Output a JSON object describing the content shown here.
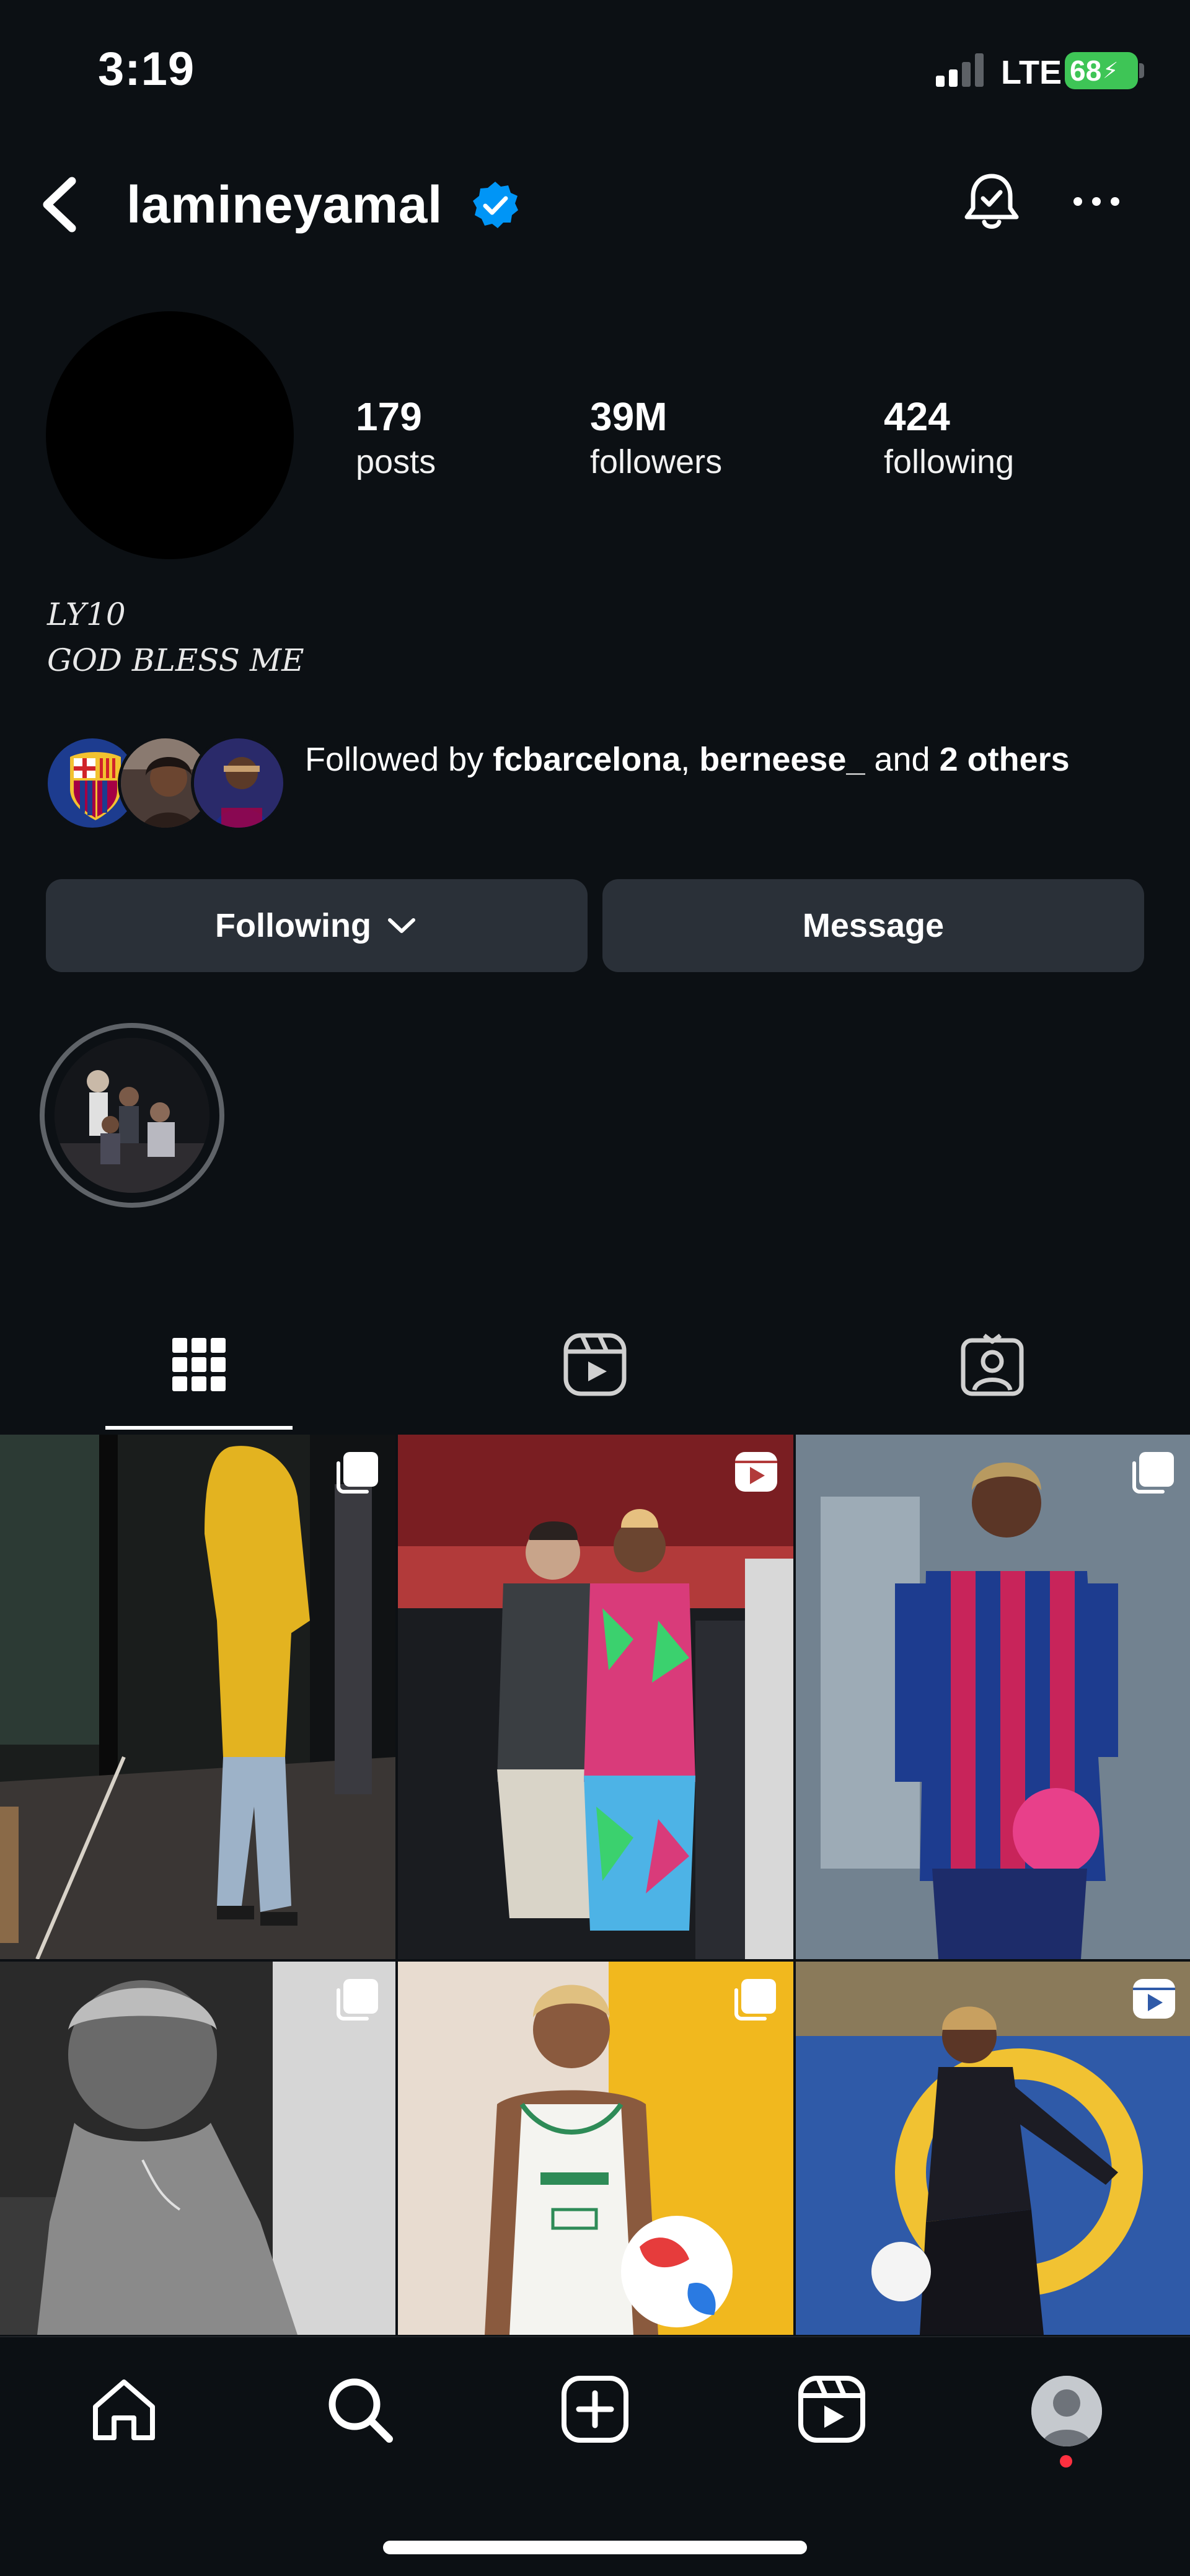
{
  "status_bar": {
    "time": "3:19",
    "network": "LTE",
    "battery": "68"
  },
  "header": {
    "username": "lamineyamal",
    "verified": true,
    "icons": [
      "back-chevron-icon",
      "verified-badge-icon",
      "bell-icon",
      "more-icon"
    ]
  },
  "profile": {
    "stats": [
      {
        "value": "179",
        "label": "posts"
      },
      {
        "value": "39M",
        "label": "followers"
      },
      {
        "value": "424",
        "label": "following"
      }
    ],
    "bio": [
      "LY10",
      "GOD BLESS ME"
    ]
  },
  "followed_by": {
    "prefix": "Followed by ",
    "user1": "fcbarcelona",
    "sep": ", ",
    "user2": "berneese_",
    "mid": " and ",
    "others": "2 others"
  },
  "actions": {
    "following_label": "Following",
    "message_label": "Message"
  },
  "tabs": [
    {
      "name": "posts",
      "icon": "grid-icon",
      "active": true
    },
    {
      "name": "reels",
      "icon": "reels-icon",
      "active": false
    },
    {
      "name": "tagged",
      "icon": "tagged-icon",
      "active": false
    }
  ],
  "grid_posts": [
    {
      "badge": "multi-post-icon",
      "theme": "yellow hoodie in glass hallway"
    },
    {
      "badge": "reels-icon",
      "theme": "two people colorful kit"
    },
    {
      "badge": "multi-post-icon",
      "theme": "barcelona jersey pink ball"
    },
    {
      "badge": "multi-post-icon",
      "theme": "black and white portrait"
    },
    {
      "badge": "multi-post-icon",
      "theme": "adidas white tank ball"
    },
    {
      "badge": "reels-icon",
      "theme": "training ball kick"
    }
  ],
  "bottom_nav": {
    "items": [
      "home-icon",
      "search-icon",
      "create-icon",
      "reels-icon",
      "profile-icon"
    ],
    "colors": {
      "notification_dot": "#ff3040"
    }
  },
  "colors": {
    "background": "#0c1014",
    "button": "#2a3038",
    "verified": "#0095f6",
    "battery": "#3ec556"
  }
}
